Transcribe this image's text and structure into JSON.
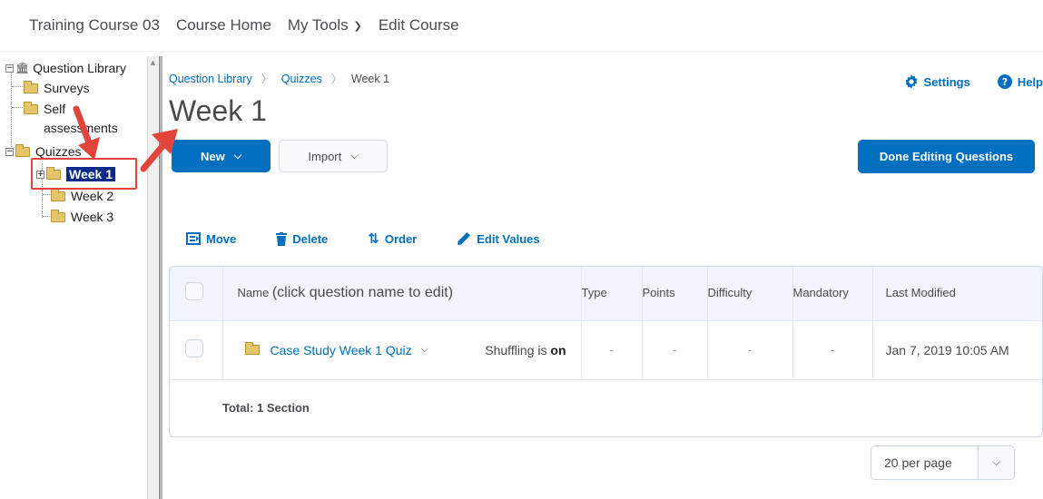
{
  "topnav": {
    "course": "Training Course 03",
    "home": "Course Home",
    "tools": "My Tools",
    "edit": "Edit Course"
  },
  "tree": {
    "root": "Question Library",
    "surveys": "Surveys",
    "self_1": "Self",
    "self_2": "assessments",
    "quizzes": "Quizzes",
    "week1": "Week 1",
    "week2": "Week 2",
    "week3": "Week 3"
  },
  "breadcrumb": {
    "library": "Question Library",
    "quizzes": "Quizzes",
    "current": "Week 1"
  },
  "page_title": "Week 1",
  "links": {
    "settings": "Settings",
    "help": "Help"
  },
  "buttons": {
    "new": "New",
    "import": "Import",
    "done": "Done Editing Questions"
  },
  "actions": {
    "move": "Move",
    "delete": "Delete",
    "order": "Order",
    "edit_values": "Edit Values"
  },
  "table": {
    "headers": {
      "name_prefix": "Name",
      "name_hint": "(click question name to edit)",
      "type": "Type",
      "points": "Points",
      "difficulty": "Difficulty",
      "mandatory": "Mandatory",
      "last_modified": "Last Modified"
    },
    "row": {
      "name": "Case Study Week 1 Quiz",
      "shuffle_prefix": "Shuffling is",
      "shuffle_state": "on",
      "type": "-",
      "points": "-",
      "difficulty": "-",
      "mandatory": "-",
      "last_modified": "Jan 7, 2019 10:05 AM"
    },
    "total": "Total: 1 Section"
  },
  "pager": {
    "value": "20 per page"
  },
  "colors": {
    "link": "#006fbf",
    "primary": "#006fbf",
    "highlight": "#e0443a",
    "tree_selected": "#0b2a8a"
  }
}
